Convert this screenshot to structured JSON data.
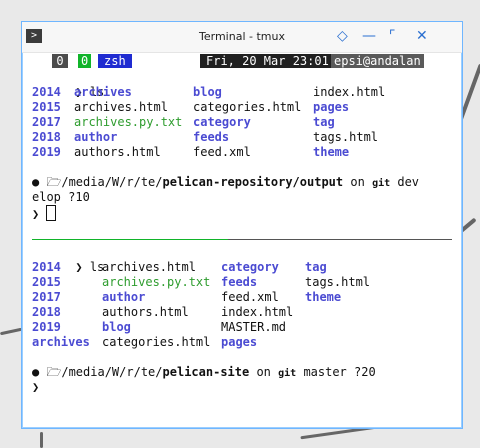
{
  "window": {
    "title": "Terminal - tmux",
    "app_icon": "terminal-icon",
    "controls": [
      {
        "name": "diamond-icon",
        "glyph": "◇"
      },
      {
        "name": "minimize-icon",
        "glyph": "—"
      },
      {
        "name": "maximize-icon",
        "glyph": "⌜"
      },
      {
        "name": "close-icon",
        "glyph": "✕"
      }
    ]
  },
  "tmux_status": {
    "session": "0",
    "window_index": "0",
    "window_name": "zsh",
    "datetime": "Fri, 20 Mar 23:01",
    "user_host": "epsi@andalan"
  },
  "pane1": {
    "prompt": "❯",
    "command": "ls",
    "rows": [
      [
        "2014",
        "archives",
        "blog",
        "index.html"
      ],
      [
        "2015",
        "archives.html",
        "categories.html",
        "pages"
      ],
      [
        "2017",
        "archives.py.txt",
        "category",
        "tag"
      ],
      [
        "2018",
        "author",
        "feeds",
        "tags.html"
      ],
      [
        "2019",
        "authors.html",
        "feed.xml",
        "theme"
      ]
    ],
    "path_bullet": "●",
    "folder_icon": "🗁",
    "path_prefix": "/media/W/r/te/",
    "path_bold": "pelican-repository/output",
    "on": "on",
    "git_icon": "git",
    "branch": "dev",
    "status_line2": "elop ?10",
    "prompt2": "❯"
  },
  "pane2": {
    "prompt": "❯",
    "command": "ls",
    "rows": [
      [
        "2014",
        "archives.html",
        "category",
        "tag"
      ],
      [
        "2015",
        "archives.py.txt",
        "feeds",
        "tags.html"
      ],
      [
        "2017",
        "author",
        "feed.xml",
        "theme"
      ],
      [
        "2018",
        "authors.html",
        "index.html",
        ""
      ],
      [
        "2019",
        "blog",
        "MASTER.md",
        ""
      ],
      [
        "archives",
        "categories.html",
        "pages",
        ""
      ]
    ],
    "path_bullet": "●",
    "folder_icon": "🗁",
    "path_prefix": "/media/W/r/te/",
    "path_bold": "pelican-site",
    "on": "on",
    "git_icon": "git",
    "branch": "master ?20",
    "prompt2": "❯"
  },
  "colors": {
    "directory": "#4b4bd2",
    "executable": "#2e9c2e",
    "tmux_green": "#11b42a",
    "tmux_blue": "#1f2bd1"
  }
}
